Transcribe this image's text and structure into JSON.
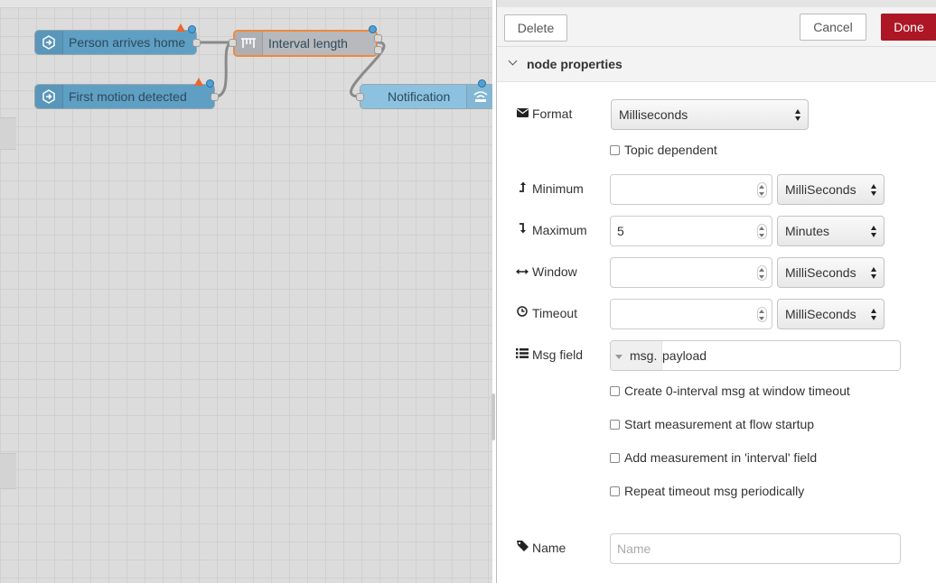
{
  "flow": {
    "nodes": [
      {
        "label": "Person arrives home"
      },
      {
        "label": "First motion detected"
      },
      {
        "label": "Interval length"
      },
      {
        "label": "Notification"
      }
    ]
  },
  "toolbar": {
    "delete_label": "Delete",
    "cancel_label": "Cancel",
    "done_label": "Done"
  },
  "section": {
    "title": "node properties"
  },
  "form": {
    "format": {
      "label": "Format",
      "icon": "envelope-icon",
      "value": "Milliseconds"
    },
    "topic_dependent": {
      "label": "Topic dependent",
      "checked": false
    },
    "minimum": {
      "label": "Minimum",
      "icon": "level-up-icon",
      "value": "",
      "unit": "MilliSeconds"
    },
    "maximum": {
      "label": "Maximum",
      "icon": "level-down-icon",
      "value": "5",
      "unit": "Minutes"
    },
    "window": {
      "label": "Window",
      "icon": "arrows-h-icon",
      "value": "",
      "unit": "MilliSeconds"
    },
    "timeout": {
      "label": "Timeout",
      "icon": "clock-icon",
      "value": "",
      "unit": "MilliSeconds"
    },
    "msg_field": {
      "label": "Msg field",
      "icon": "list-icon",
      "prefix": "msg.",
      "value": "payload"
    },
    "options": [
      {
        "label": "Create 0-interval msg at window timeout",
        "checked": false
      },
      {
        "label": "Start measurement at flow startup",
        "checked": false
      },
      {
        "label": "Add measurement in 'interval' field",
        "checked": false
      },
      {
        "label": "Repeat timeout msg periodically",
        "checked": false
      }
    ],
    "name": {
      "label": "Name",
      "icon": "tag-icon",
      "placeholder": "Name",
      "value": ""
    }
  },
  "colors": {
    "done": "#ad1625",
    "selected_outline": "#ee8a3b",
    "inject_node": "#5f9fc4"
  }
}
